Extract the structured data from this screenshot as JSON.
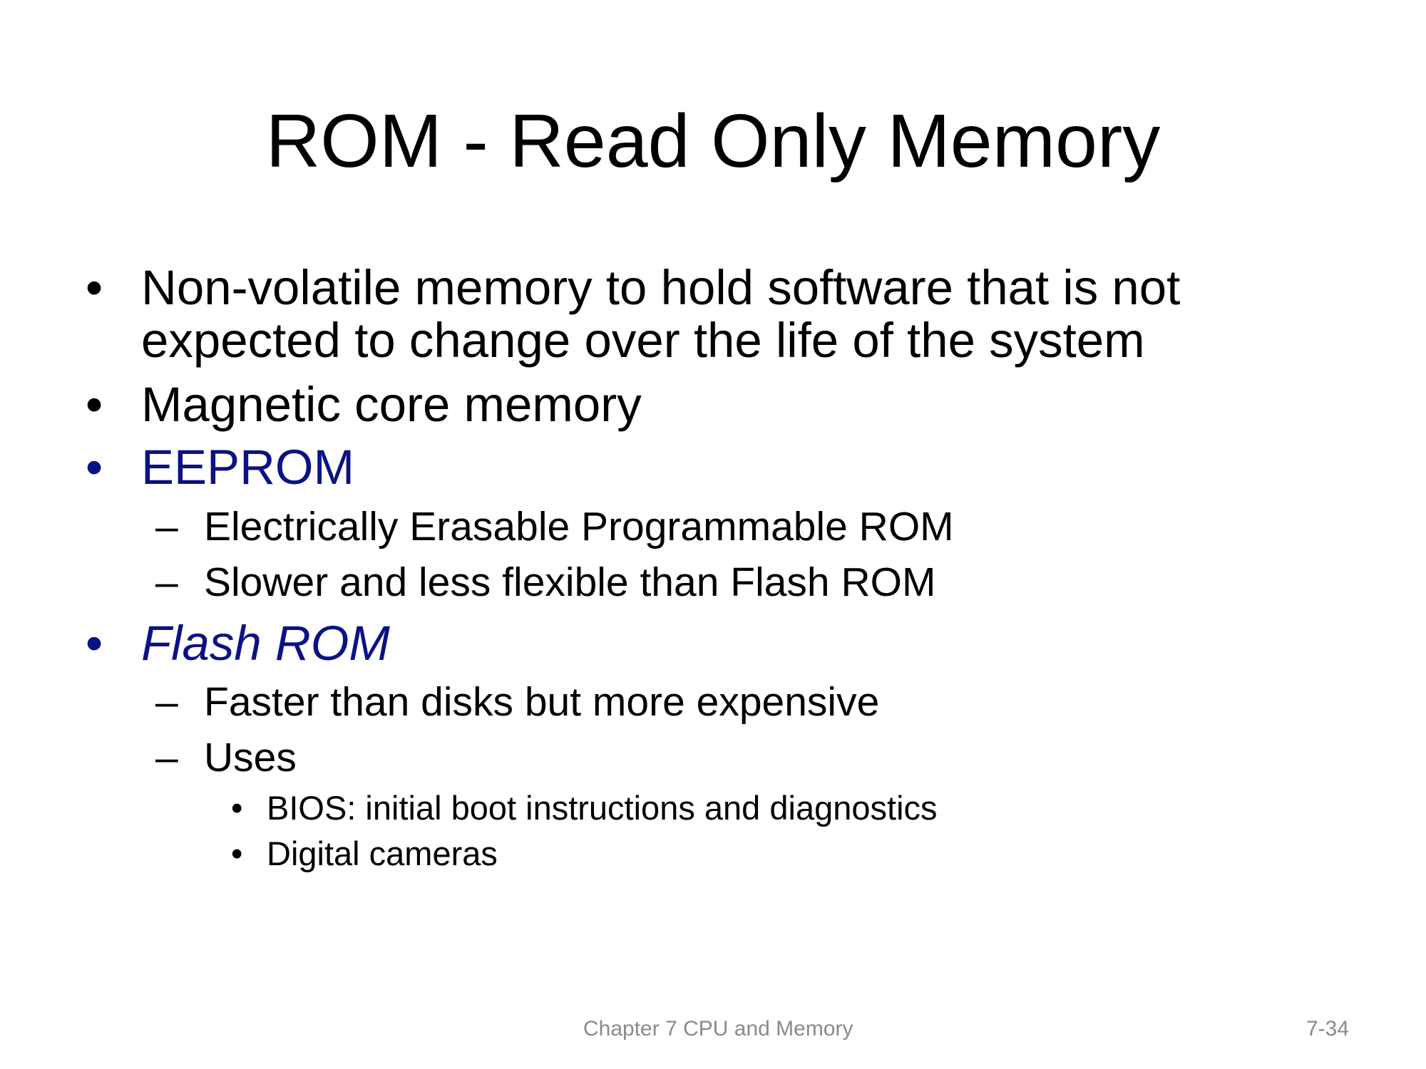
{
  "slide": {
    "title": "ROM - Read Only Memory",
    "bullets": [
      {
        "marker": "•",
        "line1": "Non-volatile memory to hold software that is not",
        "line2": "expected to change over the life of the system"
      },
      {
        "marker": "•",
        "text": "Magnetic core memory"
      },
      {
        "marker": "•",
        "text": "EEPROM"
      },
      {
        "marker": "–",
        "text": "Electrically Erasable Programmable ROM"
      },
      {
        "marker": "–",
        "text": "Slower and less flexible than Flash ROM"
      },
      {
        "marker": "•",
        "text": "Flash ROM"
      },
      {
        "marker": "–",
        "text": "Faster than disks but more expensive"
      },
      {
        "marker": "–",
        "text": "Uses"
      },
      {
        "marker": "•",
        "text": "BIOS: initial boot instructions and diagnostics"
      },
      {
        "marker": "•",
        "text": "Digital cameras"
      }
    ],
    "accent_color": "#0b1283"
  },
  "footer": {
    "chapter": "Chapter 7 CPU and Memory",
    "page_number": "7-34"
  }
}
